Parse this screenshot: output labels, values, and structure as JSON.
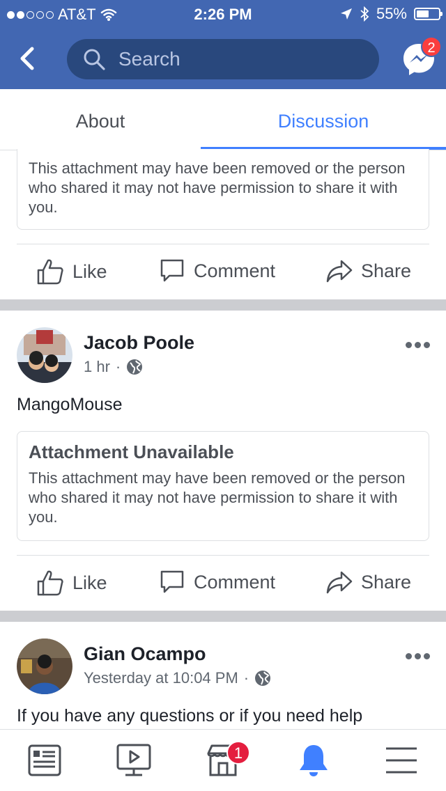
{
  "status_bar": {
    "carrier": "AT&T",
    "time": "2:26 PM",
    "battery": "55%",
    "battery_level": 0.55,
    "signal_strength": 2
  },
  "nav": {
    "search_placeholder": "Search",
    "messenger_badge": "2"
  },
  "tabs": [
    {
      "label": "About",
      "active": false
    },
    {
      "label": "Discussion",
      "active": true
    }
  ],
  "posts": [
    {
      "attachment_body": "This attachment may have been removed or the person who shared it may not have permission to share it with you.",
      "actions": [
        "Like",
        "Comment",
        "Share"
      ]
    },
    {
      "author": "Jacob Poole",
      "time": "1 hr",
      "text": "MangoMouse",
      "attachment_title": "Attachment Unavailable",
      "attachment_body": "This attachment may have been removed or the person who shared it may not have permission to share it with you.",
      "actions": [
        "Like",
        "Comment",
        "Share"
      ]
    },
    {
      "author": "Gian Ocampo",
      "time": "Yesterday at 10:04 PM",
      "text": "If you have any questions or if you need help"
    }
  ],
  "tab_bar": {
    "marketplace_badge": "1",
    "items": [
      "news-feed-icon",
      "video-icon",
      "marketplace-icon",
      "notifications-icon",
      "menu-icon"
    ]
  },
  "colors": {
    "brand": "#4267b2",
    "active_tab": "#4080ff",
    "badge": "#fa3e3e"
  }
}
